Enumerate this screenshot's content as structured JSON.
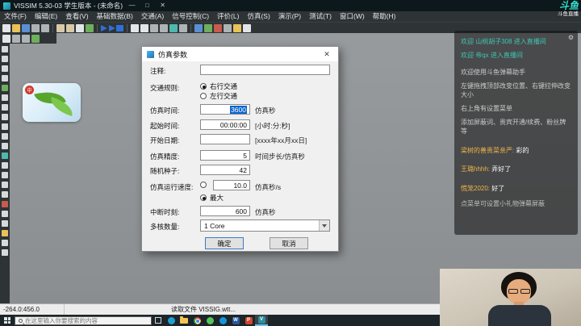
{
  "titlebar": {
    "title": "VISSIM 5.30-03 学生版本 - (未命名)"
  },
  "menubar": {
    "items": [
      "文件(F)",
      "编辑(E)",
      "查看(V)",
      "基础数据(B)",
      "交通(A)",
      "信号控制(C)",
      "评价(L)",
      "仿真(S)",
      "演示(P)",
      "测试(T)",
      "窗口(W)",
      "帮助(H)"
    ]
  },
  "toolbar": {
    "icons": [
      "new-file-icon",
      "open-file-icon",
      "save-icon",
      "read-additionally-icon",
      "print-icon",
      "cut-icon",
      "copy-icon",
      "paste-icon",
      "undo-icon",
      "run-continuous-icon",
      "run-single-step-icon",
      "run-stop-icon",
      "zoom-in-icon",
      "zoom-out-icon",
      "zoom-window-icon",
      "pan-icon",
      "rotate-network-icon",
      "measure-icon",
      "links-icon",
      "connectors-icon",
      "signal-heads-icon",
      "detectors-icon",
      "evaluation-icon",
      "help-icon"
    ]
  },
  "toolbar2": {
    "icons": [
      "new-window-icon",
      "tile-windows-icon",
      "cascade-windows-icon",
      "refresh-icon"
    ]
  },
  "side_toolbar": {
    "icons": [
      "select-mode-icon",
      "links-mode-icon",
      "connectors-mode-icon",
      "desired-speed-icon",
      "reduced-speed-icon",
      "stop-signs-icon",
      "signal-heads-mode-icon",
      "detectors-mode-icon",
      "vehicle-inputs-icon",
      "routes-icon",
      "conflict-areas-icon",
      "priority-rules-icon",
      "parking-lots-icon",
      "transit-stops-icon",
      "transit-lines-icon",
      "nodes-icon",
      "measurement-points-icon",
      "travel-time-icon",
      "queue-counters-icon",
      "data-points-icon",
      "pavement-markings-icon",
      "background-icon"
    ]
  },
  "canvas_image": {
    "badge": "中"
  },
  "dialog": {
    "title": "仿真参数",
    "comment": {
      "label": "注释:",
      "value": ""
    },
    "traffic_rule": {
      "label": "交通规则:",
      "options": [
        "右行交通",
        "左行交通"
      ],
      "selected": "右行交通"
    },
    "sim_time": {
      "label": "仿真时间:",
      "value": "3600",
      "unit": "仿真秒"
    },
    "start_time": {
      "label": "起始时间:",
      "value": "00:00:00",
      "unit": "[小时:分:秒]"
    },
    "start_date": {
      "label": "开始日期:",
      "value": "",
      "unit": "[xxxx年xx月xx日]"
    },
    "resolution": {
      "label": "仿真精度:",
      "value": "5",
      "unit": "时间步长/仿真秒"
    },
    "random_seed": {
      "label": "随机种子:",
      "value": "42"
    },
    "sim_speed": {
      "label": "仿真运行速度:",
      "value": "10.0",
      "unit": "仿真秒/s",
      "max_label": "最大",
      "selected": "最大"
    },
    "break_at": {
      "label": "中断时刻:",
      "value": "600",
      "unit": "仿真秒"
    },
    "cores": {
      "label": "多核数量:",
      "value": "1 Core"
    },
    "ok": "确定",
    "cancel": "取消"
  },
  "chat": {
    "messages": [
      {
        "type": "welcome",
        "text": "欢迎 山桃胡子308 进入直播间"
      },
      {
        "type": "welcome",
        "text": "欢迎 帝qx 进入直播间"
      },
      {
        "type": "system",
        "text": "欢迎使用斗鱼弹幕助手"
      },
      {
        "type": "system",
        "text": "左键拖拽顶部改变位置、右键拉伸改变大小"
      },
      {
        "type": "system",
        "text": "右上角有设置菜单"
      },
      {
        "type": "system",
        "text": "添加屏蔽词、贵宾开通/续费、粉丝牌等"
      },
      {
        "type": "user",
        "user": "梁树的善贵菜亲严:",
        "text": "彩的"
      },
      {
        "type": "user",
        "user": "王璐hhhh:",
        "text": "弄好了"
      },
      {
        "type": "user",
        "user": "慌笼2020:",
        "text": "好了"
      },
      {
        "type": "hint",
        "text": "点菜单可设置小礼物弹幕屏蔽"
      }
    ]
  },
  "watermark": {
    "brand": "斗鱼",
    "sub": "斗鱼直播"
  },
  "statusbar": {
    "message": "读取文件 VISSIG.wtt...",
    "coords": "-264.0:456.0"
  },
  "taskbar": {
    "search_placeholder": "在这里输入你要搜索的内容"
  }
}
